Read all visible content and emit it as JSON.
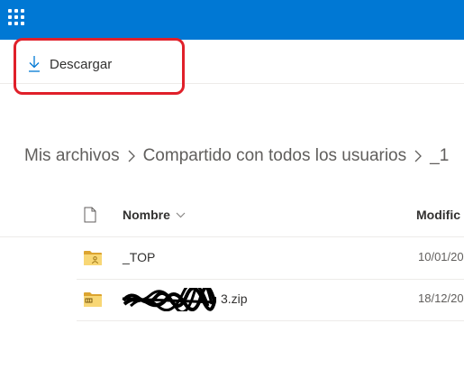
{
  "app": {
    "launcher_icon": "waffle-icon",
    "accent_color": "#0078d4"
  },
  "commandbar": {
    "download_label": "Descargar",
    "download_icon": "download-icon",
    "highlight_color": "#e0202a"
  },
  "breadcrumb": {
    "items": [
      "Mis archivos",
      "Compartido con todos los usuarios",
      "_1"
    ]
  },
  "list": {
    "columns": {
      "type_icon": "file-icon",
      "name": "Nombre",
      "modified": "Modific"
    },
    "rows": [
      {
        "name": "_TOP",
        "modified": "10/01/20",
        "icon": "shared-folder-icon"
      },
      {
        "name": "3.zip",
        "modified": "18/12/20",
        "icon": "zip-folder-icon"
      }
    ]
  }
}
